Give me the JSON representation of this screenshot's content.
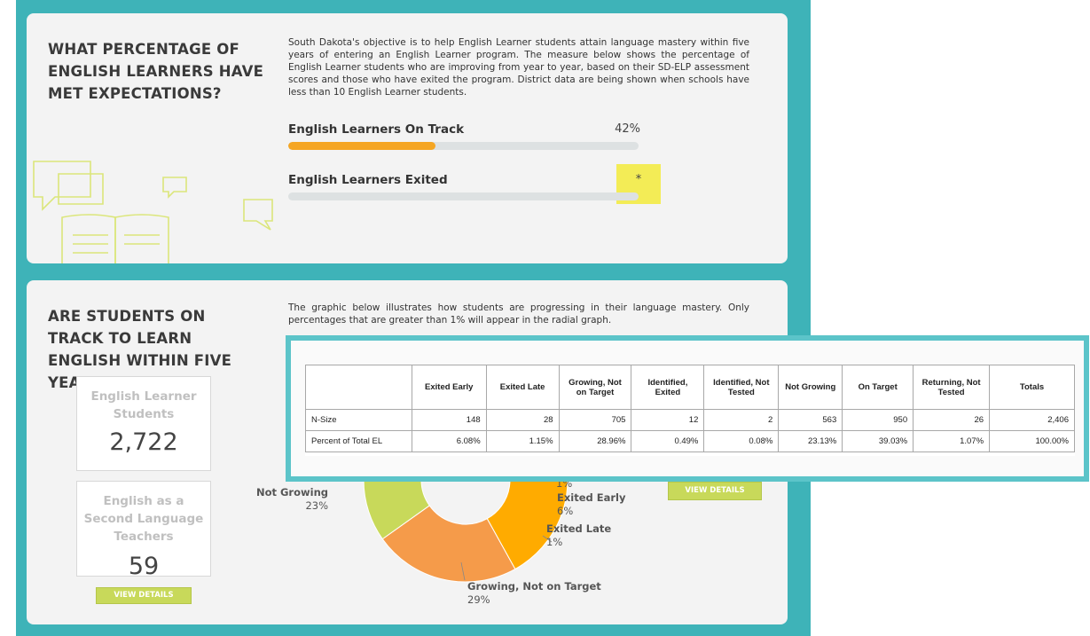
{
  "card1": {
    "title": "WHAT PERCENTAGE OF ENGLISH LEARNERS HAVE MET EXPECTATIONS?",
    "description": "South Dakota's objective is to help English Learner students attain language mastery within five years of entering an English Learner program. The measure below shows the percentage of English Learner students who are improving from year to year, based on their SD-ELP assessment scores and those who have exited the program. District data are being shown when schools have less than 10 English Learner students.",
    "metrics": [
      {
        "label": "English Learners On Track",
        "value": "42%",
        "fill_percent": 42
      },
      {
        "label": "English Learners Exited",
        "value": "*",
        "fill_percent": 0
      }
    ],
    "colors": {
      "bar_fill": "#f5a623",
      "highlight": "#f2ea3a"
    }
  },
  "card2": {
    "title": "ARE STUDENTS ON TRACK TO LEARN ENGLISH WITHIN FIVE YEARS?",
    "description": "The graphic below illustrates how students are progressing in their language mastery.  Only percentages that are greater than 1% will appear in the radial graph.",
    "stats": [
      {
        "label": "English Learner Students",
        "value": "2,722"
      },
      {
        "label": "English as a Second Language Teachers",
        "value": "59"
      }
    ],
    "view_details_left": "VIEW DETAILS",
    "view_details_right": "VIEW DETAILS",
    "donut_labels": {
      "not_growing_name": "Not Growing",
      "not_growing_pct": "23%",
      "exited_early_name": "Exited Early",
      "exited_early_pct": "6%",
      "exited_late_name": "Exited Late",
      "exited_late_pct": "1%",
      "growing_name": "Growing, Not on Target",
      "growing_pct": "29%",
      "partial_pct": "1%"
    },
    "chart_data": {
      "type": "pie",
      "categories": [
        "Exited Early",
        "Exited Late",
        "Growing, Not on Target",
        "Not Growing",
        "On Target",
        "Identified, Exited"
      ],
      "values": [
        6,
        1,
        29,
        23,
        39,
        1
      ],
      "colors": [
        "#eeeeee",
        "#e06a2a",
        "#ffab00",
        "#f59b4a",
        "#c8d95a",
        "#e7b3b3"
      ]
    }
  },
  "table": {
    "headers": [
      "",
      "Exited Early",
      "Exited Late",
      "Growing, Not on Target",
      "Identified, Exited",
      "Identified, Not Tested",
      "Not Growing",
      "On Target",
      "Returning, Not Tested",
      "Totals"
    ],
    "rows": [
      {
        "label": "N-Size",
        "cells": [
          "148",
          "28",
          "705",
          "12",
          "2",
          "563",
          "950",
          "26",
          "2,406"
        ]
      },
      {
        "label": "Percent of Total EL",
        "cells": [
          "6.08%",
          "1.15%",
          "28.96%",
          "0.49%",
          "0.08%",
          "23.13%",
          "39.03%",
          "1.07%",
          "100.00%"
        ]
      }
    ]
  }
}
